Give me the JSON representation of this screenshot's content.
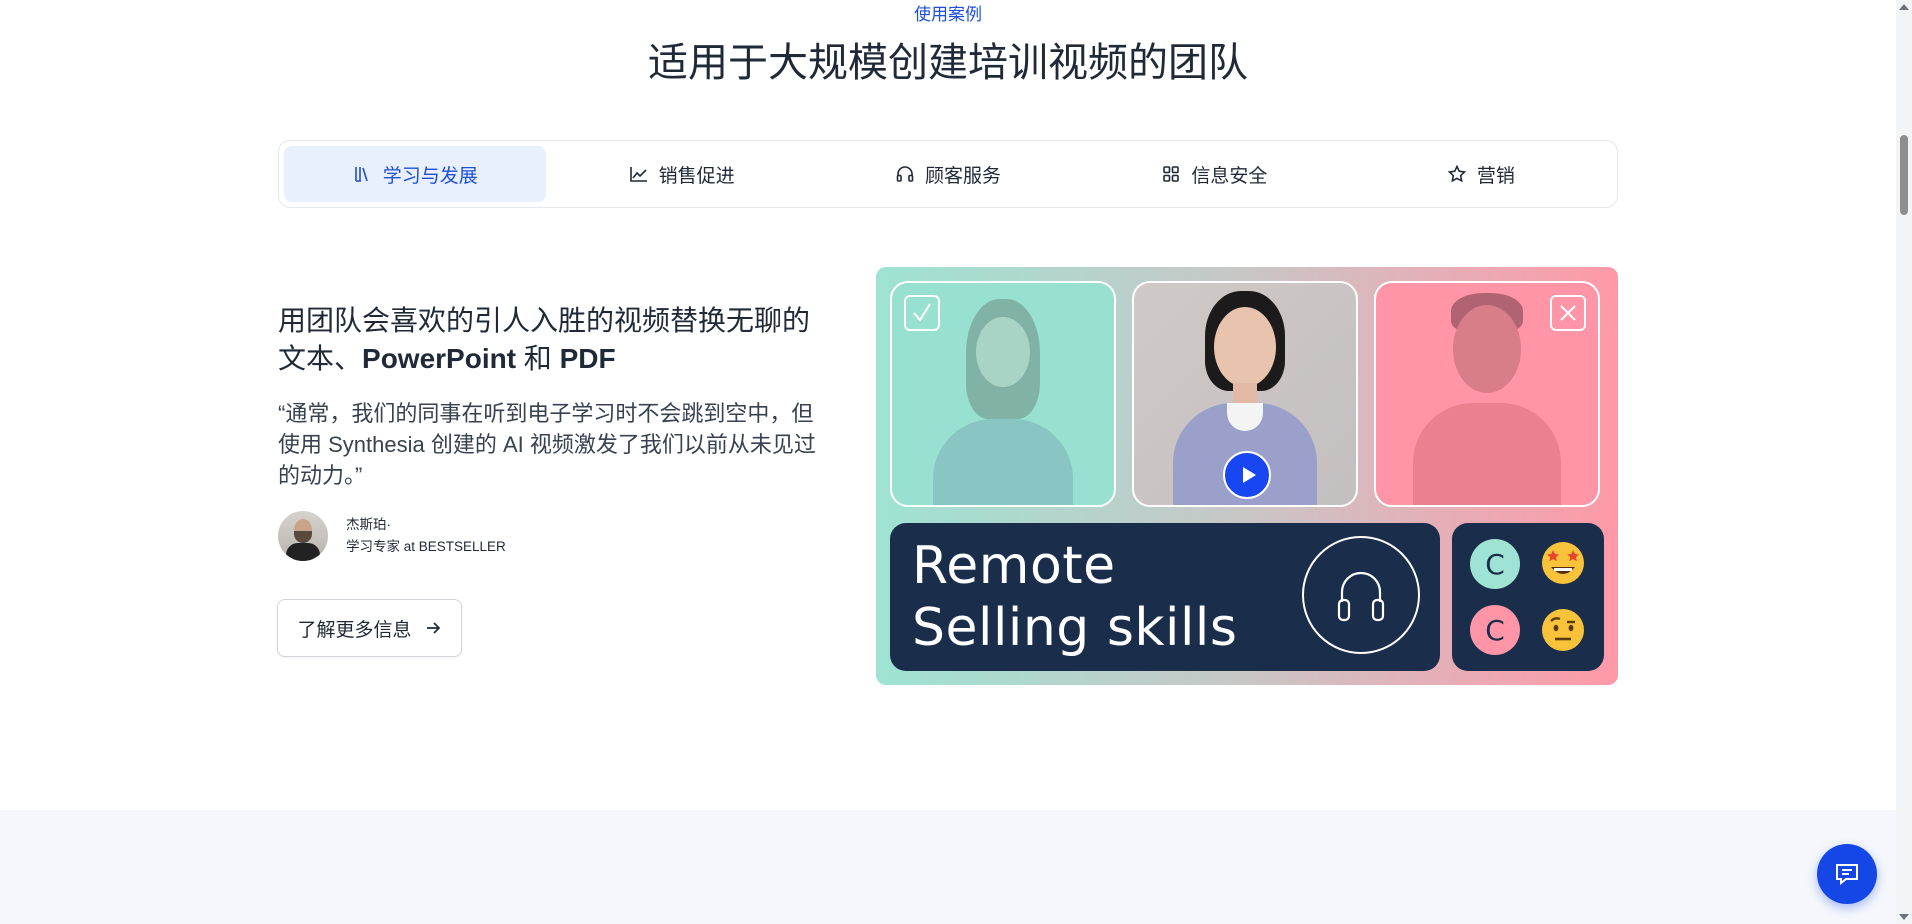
{
  "section": {
    "eyebrow": "使用案例",
    "headline": "适用于大规模创建培训视频的团队"
  },
  "tabs": [
    {
      "label": "学习与发展",
      "icon": "books-icon",
      "active": true
    },
    {
      "label": "销售促进",
      "icon": "chart-line-icon",
      "active": false
    },
    {
      "label": "顾客服务",
      "icon": "headset-icon",
      "active": false
    },
    {
      "label": "信息安全",
      "icon": "grid-icon",
      "active": false
    },
    {
      "label": "营销",
      "icon": "star-icon",
      "active": false
    }
  ],
  "case": {
    "title_part1": "用团队会喜欢的引人入胜的视频替换无聊的文本、",
    "title_bold1": "PowerPoint",
    "title_and": " 和 ",
    "title_bold2": "PDF",
    "quote": "“通常，我们的同事在听到电子学习时不会跳到空中，但使用 Synthesia 创建的 AI 视频激发了我们以前从未见过的动力。”",
    "author_name": "杰斯珀·",
    "author_role": "学习专家 at BESTSELLER",
    "cta_label": "了解更多信息"
  },
  "visual": {
    "banner_line1": "Remote",
    "banner_line2": "Selling skills",
    "chip_top": "C",
    "chip_bottom": "C",
    "colors": {
      "mint": "#9ee3d3",
      "pink": "#ff95a6",
      "navy": "#1a2e4c",
      "play": "#1746f2"
    }
  },
  "accent_color": "#1d4ed8"
}
